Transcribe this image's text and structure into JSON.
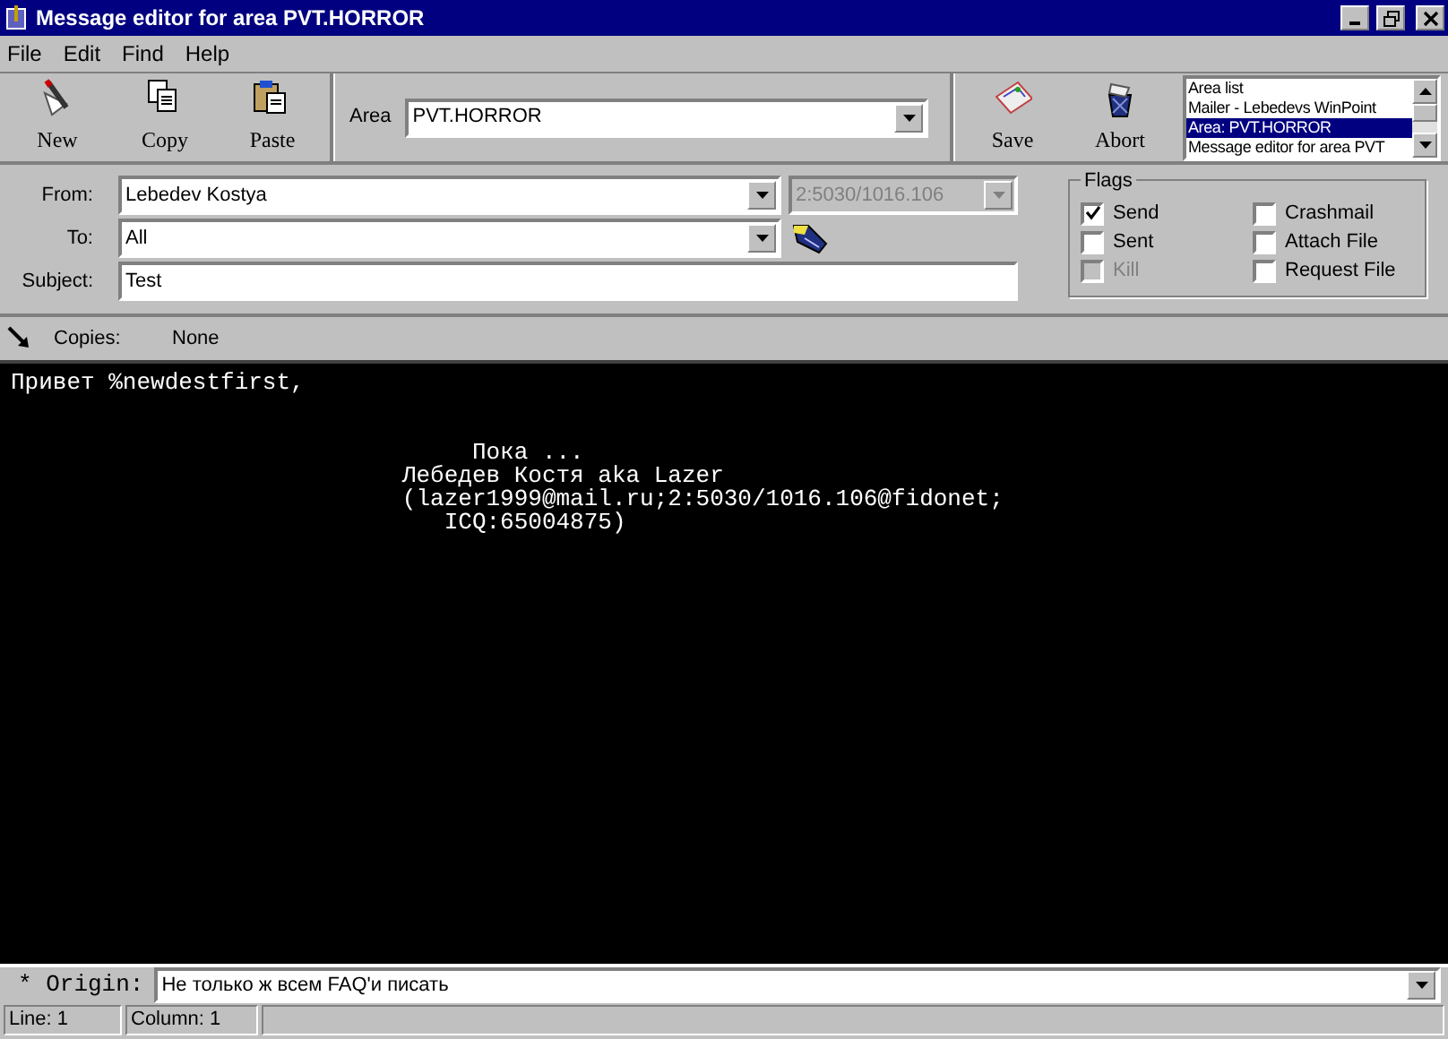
{
  "window": {
    "title": "Message editor for area PVT.HORROR"
  },
  "menu": [
    "File",
    "Edit",
    "Find",
    "Help"
  ],
  "toolbar_left": [
    {
      "kind": "new",
      "label": "New"
    },
    {
      "kind": "copy",
      "label": "Copy"
    },
    {
      "kind": "paste",
      "label": "Paste"
    }
  ],
  "area": {
    "label": "Area",
    "value": "PVT.HORROR"
  },
  "toolbar_right": [
    {
      "kind": "save",
      "label": "Save"
    },
    {
      "kind": "abort",
      "label": "Abort"
    }
  ],
  "window_list": [
    {
      "label": "Area list",
      "selected": false
    },
    {
      "label": "Mailer - Lebedevs WinPoint",
      "selected": false
    },
    {
      "label": "Area: PVT.HORROR",
      "selected": true
    },
    {
      "label": "Message editor for area PVT",
      "selected": false
    }
  ],
  "header": {
    "from": {
      "label": "From:",
      "value": "Lebedev Kostya",
      "address": "2:5030/1016.106"
    },
    "to": {
      "label": "To:",
      "value": "All"
    },
    "subject": {
      "label": "Subject:",
      "value": "Test"
    }
  },
  "flags": {
    "title": "Flags",
    "items": [
      {
        "label": "Send",
        "checked": true,
        "disabled": false
      },
      {
        "label": "Crashmail",
        "checked": false,
        "disabled": false
      },
      {
        "label": "Sent",
        "checked": false,
        "disabled": false
      },
      {
        "label": "Attach File",
        "checked": false,
        "disabled": false
      },
      {
        "label": "Kill",
        "checked": false,
        "disabled": true
      },
      {
        "label": "Request File",
        "checked": false,
        "disabled": false
      }
    ]
  },
  "copies": {
    "label": "Copies:",
    "value": "None"
  },
  "editor": {
    "text": "Привет %newdestfirst,\n\n\n                                 Пока ...\n                            Лебедев Костя aka Lazer\n                            (lazer1999@mail.ru;2:5030/1016.106@fidonet;\n                               ICQ:65004875)"
  },
  "origin": {
    "label": "* Origin:",
    "value": "Не только ж всем FAQ'и писать"
  },
  "status_bar": [
    "Line: 1",
    "Column: 1"
  ]
}
